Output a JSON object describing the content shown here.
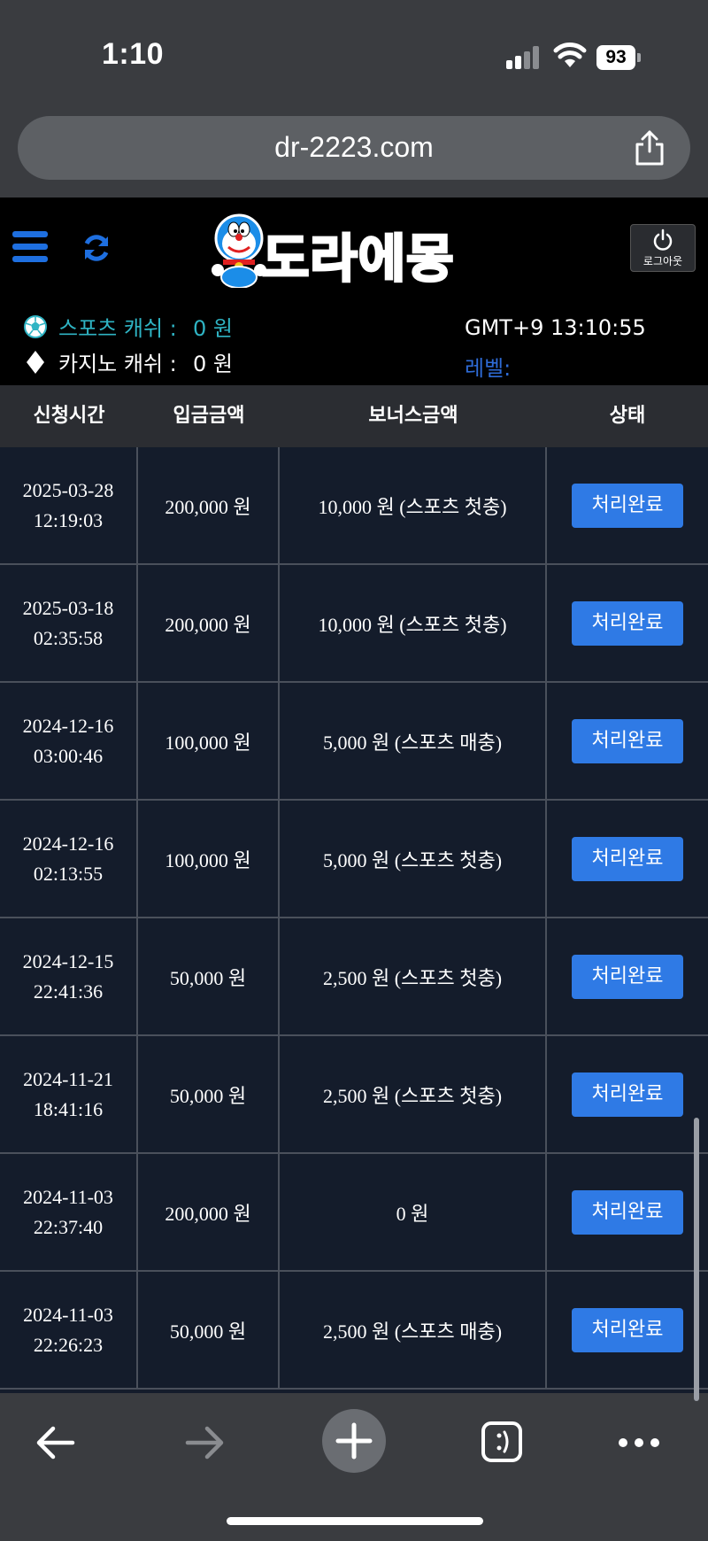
{
  "status_bar": {
    "time": "1:10",
    "battery": "93"
  },
  "browser": {
    "url": "dr-2223.com"
  },
  "header": {
    "logo_text": "도라에몽",
    "logout_label": "로그아웃",
    "sports_cash_label": "스포츠 캐쉬 :",
    "sports_cash_value": "0 원",
    "casino_cash_label": "카지노 캐쉬 :",
    "casino_cash_value": "0 원",
    "clock": "GMT+9 13:10:55",
    "level_label": "레벨:"
  },
  "table": {
    "headers": [
      "신청시간",
      "입금금액",
      "보너스금액",
      "상태"
    ],
    "rows": [
      {
        "date": "2025-03-28",
        "time": "12:19:03",
        "amount": "200,000 원",
        "bonus": "10,000 원 (스포츠 첫충)",
        "status": "처리완료"
      },
      {
        "date": "2025-03-18",
        "time": "02:35:58",
        "amount": "200,000 원",
        "bonus": "10,000 원 (스포츠 첫충)",
        "status": "처리완료"
      },
      {
        "date": "2024-12-16",
        "time": "03:00:46",
        "amount": "100,000 원",
        "bonus": "5,000 원 (스포츠 매충)",
        "status": "처리완료"
      },
      {
        "date": "2024-12-16",
        "time": "02:13:55",
        "amount": "100,000 원",
        "bonus": "5,000 원 (스포츠 첫충)",
        "status": "처리완료"
      },
      {
        "date": "2024-12-15",
        "time": "22:41:36",
        "amount": "50,000 원",
        "bonus": "2,500 원 (스포츠 첫충)",
        "status": "처리완료"
      },
      {
        "date": "2024-11-21",
        "time": "18:41:16",
        "amount": "50,000 원",
        "bonus": "2,500 원 (스포츠 첫충)",
        "status": "처리완료"
      },
      {
        "date": "2024-11-03",
        "time": "22:37:40",
        "amount": "200,000 원",
        "bonus": "0 원",
        "status": "처리완료"
      },
      {
        "date": "2024-11-03",
        "time": "22:26:23",
        "amount": "50,000 원",
        "bonus": "2,500 원 (스포츠 매충)",
        "status": "처리완료"
      }
    ]
  },
  "colors": {
    "accent_blue": "#2f7ae5",
    "sports_cyan": "#2fb4c4",
    "level_blue": "#2e6bd6",
    "table_bg": "#141c2b"
  }
}
